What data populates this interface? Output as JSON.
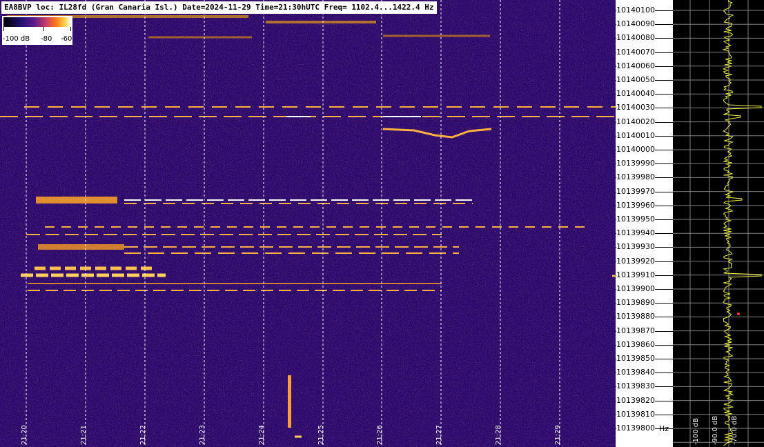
{
  "header": {
    "title": "EA8BVP loc: IL28fd (Gran Canaria Isl.) Date=2024-11-29 Time=21:30hUTC Freq= 1102.4...1422.4 Hz"
  },
  "colorbar": {
    "labels": [
      "-100 dB",
      "-80",
      "-60"
    ]
  },
  "time_axis": {
    "labels": [
      "21:20",
      "21:21",
      "21:22",
      "21:23",
      "21:24",
      "21:25",
      "21:26",
      "21:27",
      "21:28",
      "21:29"
    ]
  },
  "freq_axis": {
    "labels": [
      "10140100",
      "10140090",
      "10140080",
      "10140070",
      "10140060",
      "10140050",
      "10140040",
      "10140030",
      "10140020",
      "10140010",
      "10140000",
      "10139990",
      "10139980",
      "10139970",
      "10139960",
      "10139950",
      "10139940",
      "10139930",
      "10139920",
      "10139910",
      "10139900",
      "10139890",
      "10139880",
      "10139870",
      "10139860",
      "10139850",
      "10139840",
      "10139830",
      "10139820",
      "10139810",
      "10139800"
    ],
    "unit": "Hz"
  },
  "spectrum": {
    "db_labels": [
      "-100 dB",
      "-90.0 dB",
      "-70.0 dB"
    ]
  },
  "colors": {
    "background": "#2a0a6a",
    "signal": "#ffb040",
    "signal_peak": "#ffffff",
    "trace": "#f0f040",
    "grid": "#808080"
  }
}
